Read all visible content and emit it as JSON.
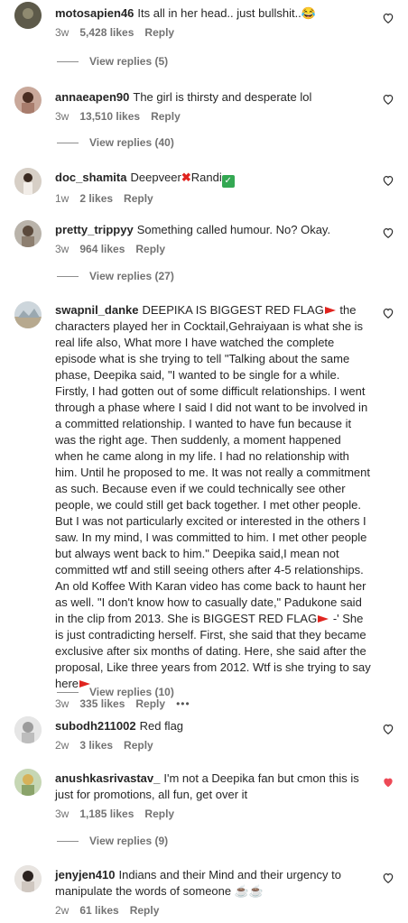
{
  "comments": [
    {
      "user": "motosapien46",
      "text": "Its all in her head.. just bullshit..😂",
      "time": "3w",
      "likes": "5,428 likes",
      "reply": "Reply",
      "view": "View replies (5)"
    },
    {
      "user": "annaeapen90",
      "text": "The girl is thirsty and desperate lol",
      "time": "3w",
      "likes": "13,510 likes",
      "reply": "Reply",
      "view": "View replies (40)"
    },
    {
      "user": "doc_shamita",
      "text_a": "Deepveer",
      "text_b": "Randi",
      "time": "1w",
      "likes": "2 likes",
      "reply": "Reply"
    },
    {
      "user": "pretty_trippyy",
      "text": "Something called humour. No? Okay.",
      "time": "3w",
      "likes": "964 likes",
      "reply": "Reply",
      "view": "View replies (27)"
    },
    {
      "user": "swapnil_danke",
      "text_a": "DEEPIKA IS BIGGEST RED FLAG",
      "text_b": " the characters played her in Cocktail,Gehraiyaan is what she is real life also, What more I have watched the complete episode what is she trying to tell \"Talking about the same phase, Deepika said, \"I wanted to be single for a while. Firstly, I had gotten out of some difficult relationships. I went through a phase where I said I did not want to be involved in a committed relationship. I wanted to have fun because it was the right age. Then suddenly, a moment happened when he came along in my life. I had no relationship with him. Until he proposed to me. It was not really a commitment as such. Because even if we could technically see other people, we could still get back together. I met other people. But I was not particularly excited or interested in the others I saw. In my mind, I was committed to him. I met other people but always went back to him.\" Deepika said,I mean not committed wtf and still seeing others after 4-5 relationships. An old Koffee With Karan video has come back to haunt her as well. \"I don't know how to casually date,\" Padukone said in the clip from 2013. She is BIGGEST RED FLAG",
      "text_c": " -' She is just contradicting herself. First, she said that they became exclusive after six months of dating. Here, she said after the proposal, Like three years from 2012. Wtf is she trying to say here",
      "time": "3w",
      "likes": "335 likes",
      "reply": "Reply",
      "more": "•••",
      "view": "View replies (10)"
    },
    {
      "user": "subodh211002",
      "text": "Red flag",
      "time": "2w",
      "likes": "3 likes",
      "reply": "Reply"
    },
    {
      "user": "anushkasrivastav_",
      "text": "I'm not a Deepika fan but cmon this is just for promotions, all fun, get over it",
      "time": "3w",
      "likes": "1,185 likes",
      "reply": "Reply",
      "view": "View replies (9)",
      "liked": true
    },
    {
      "user": "jenyjen410",
      "text": "Indians and their Mind and their urgency to manipulate the words of someone ☕☕",
      "time": "2w",
      "likes": "61 likes",
      "reply": "Reply"
    }
  ],
  "colors": {
    "liked_heart": "#ed4956",
    "muted": "#737373",
    "red_flag": "#e0241f"
  },
  "icons": {
    "like": "heart-outline-icon",
    "liked": "heart-filled-icon"
  }
}
